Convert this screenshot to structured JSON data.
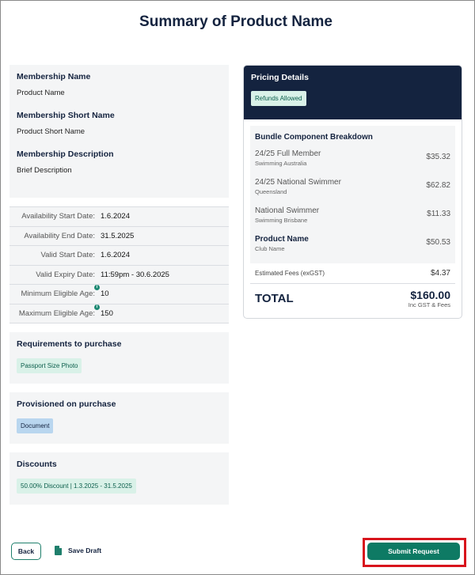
{
  "page": {
    "title": "Summary of Product Name"
  },
  "membership": {
    "name_label": "Membership Name",
    "name_value": "Product Name",
    "short_name_label": "Membership Short Name",
    "short_name_value": "Product Short Name",
    "description_label": "Membership Description",
    "description_value": "Brief Description"
  },
  "dates": [
    {
      "label": "Availability Start Date:",
      "value": "1.6.2024"
    },
    {
      "label": "Availability End Date:",
      "value": "31.5.2025"
    },
    {
      "label": "Valid Start Date:",
      "value": "1.6.2024"
    },
    {
      "label": "Valid Expiry Date:",
      "value": "11:59pm - 30.6.2025"
    },
    {
      "label": "Minimum Eligible Age:",
      "value": "10",
      "info": "i"
    },
    {
      "label": "Maximum Eligible Age:",
      "value": "150",
      "info": "i"
    }
  ],
  "requirements": {
    "label": "Requirements to purchase",
    "chip": "Passport Size Photo"
  },
  "provisioned": {
    "label": "Provisioned on purchase",
    "chip": "Document"
  },
  "discounts": {
    "label": "Discounts",
    "chip": "50.00% Discount | 1.3.2025 - 31.5.2025"
  },
  "pricing": {
    "title": "Pricing Details",
    "badge": "Refunds Allowed",
    "breakdown_title": "Bundle Component Breakdown",
    "items": [
      {
        "name": "24/25 Full Member",
        "sub": "Swimming Australia",
        "price": "$35.32"
      },
      {
        "name": "24/25 National Swimmer",
        "sub": "Queensland",
        "price": "$62.82"
      },
      {
        "name": "National Swimmer",
        "sub": "Swimming Brisbane",
        "price": "$11.33"
      },
      {
        "name": "Product Name",
        "sub": "Club Name",
        "price": "$50.53"
      }
    ],
    "fees_label": "Estimated Fees (exGST)",
    "fees_value": "$4.37",
    "total_label": "TOTAL",
    "total_value": "$160.00",
    "total_sub": "Inc GST & Fees"
  },
  "footer": {
    "back_label": "Back",
    "save_draft_label": "Save Draft",
    "submit_label": "Submit Request"
  },
  "colors": {
    "navy": "#14233f",
    "teal": "#0e7a64",
    "highlight": "#d8141c",
    "panel": "#f4f5f6"
  }
}
